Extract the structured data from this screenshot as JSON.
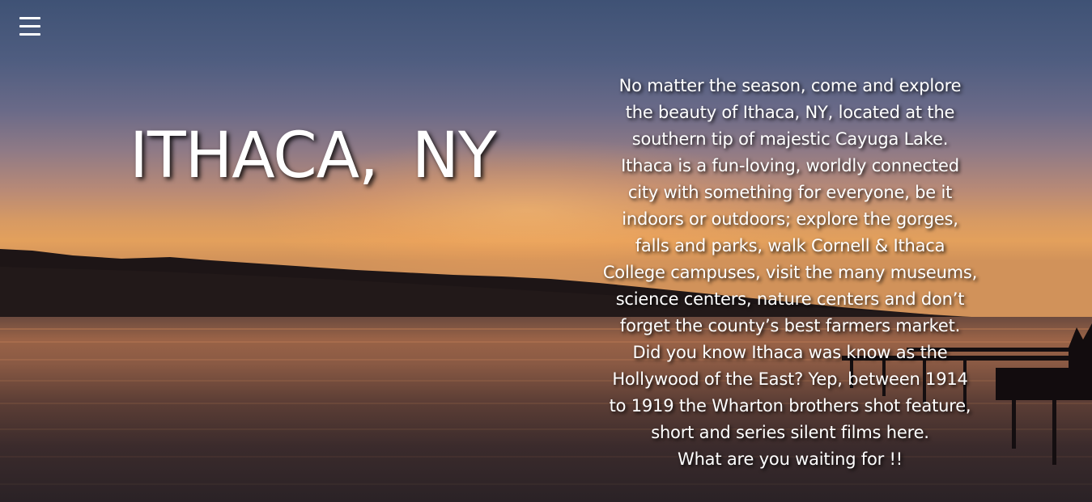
{
  "menu": {
    "icon": "hamburger-menu-icon"
  },
  "hero": {
    "title": "ITHACA, NY",
    "paragraph_lines": [
      "No matter the season, come and explore",
      "the beauty of Ithaca, NY, located at the",
      "southern tip of majestic Cayuga Lake.",
      "Ithaca is a fun-loving, worldly connected",
      "city with something for everyone, be it",
      "indoors or outdoors; explore the gorges,",
      "falls and parks, walk Cornell & Ithaca",
      "College campuses, visit the many museums,",
      "science centers, nature centers and don’t",
      "forget the county’s best farmers market.",
      "Did you know Ithaca was know as the",
      "Hollywood of the East? Yep, between 1914",
      "to 1919 the Wharton brothers shot feature,",
      "short and series silent films here.",
      "What are you waiting for !!"
    ]
  },
  "colors": {
    "text": "#ffffff",
    "sky_top": "#3f5275",
    "horizon": "#e3a05c"
  }
}
